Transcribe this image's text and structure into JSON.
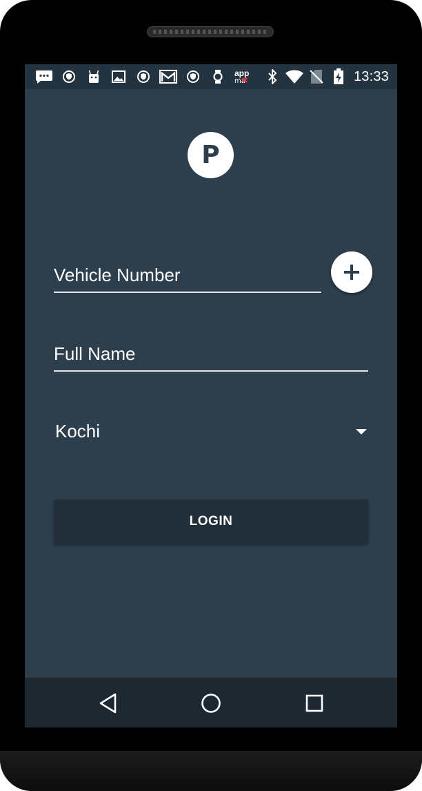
{
  "status_bar": {
    "time": "13:33",
    "left_icons": [
      "message-icon",
      "shield-icon",
      "android-icon",
      "image-icon",
      "shield-icon",
      "gmail-icon",
      "shield-icon",
      "watch-icon",
      "app-icon"
    ],
    "app_icon_text": "app",
    "right_icons": [
      "bluetooth-icon",
      "wifi-icon",
      "no-sim-icon",
      "battery-charging-icon"
    ]
  },
  "logo": {
    "letter": "P"
  },
  "form": {
    "vehicle_number_placeholder": "Vehicle Number",
    "full_name_placeholder": "Full Name",
    "city_selected": "Kochi",
    "login_label": "LOGIN"
  },
  "colors": {
    "screen_bg": "#2d3e4c",
    "status_bar_bg": "#243340",
    "button_bg": "#222f3a",
    "nav_bar_bg": "#1d2830"
  }
}
